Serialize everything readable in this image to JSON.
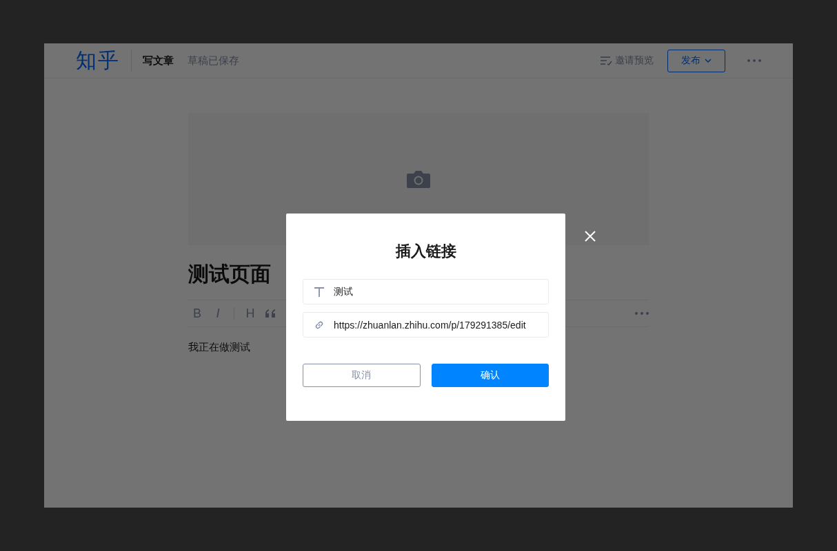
{
  "header": {
    "logo": "知乎",
    "mode": "写文章",
    "draft_status": "草稿已保存",
    "preview_label": "邀请预览",
    "publish_label": "发布"
  },
  "editor": {
    "title": "测试页面",
    "toolbar": [
      "B",
      "I",
      "H"
    ],
    "body": "我正在做测试"
  },
  "dialog": {
    "title": "插入链接",
    "text_value": "测试",
    "link_value": "https://zhuanlan.zhihu.com/p/179291385/edit",
    "cancel": "取消",
    "confirm": "确认"
  }
}
